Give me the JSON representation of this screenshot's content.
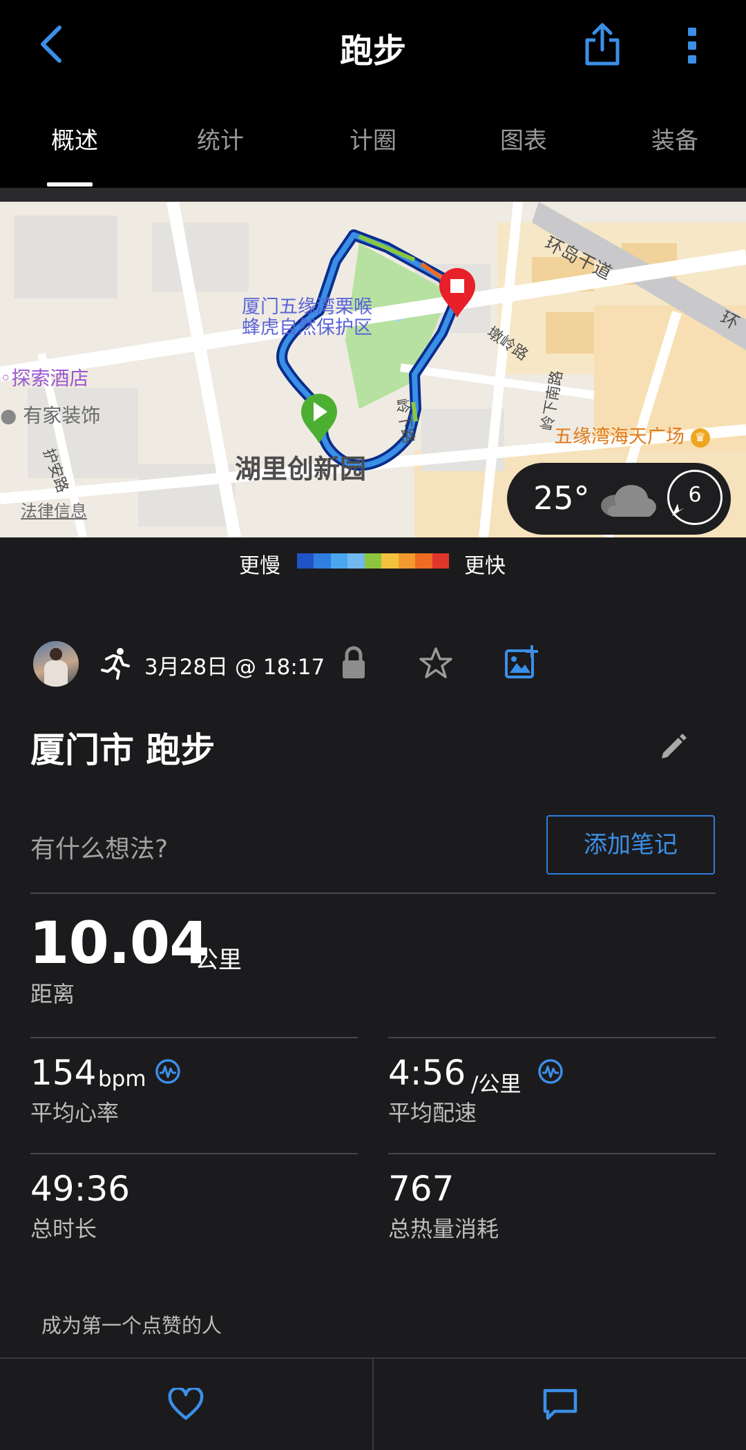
{
  "header": {
    "title": "跑步",
    "back_icon": "chevron-left-icon",
    "share_icon": "share-icon",
    "more_icon": "more-vertical-icon"
  },
  "tabs": [
    {
      "label": "概述",
      "active": true
    },
    {
      "label": "统计",
      "active": false
    },
    {
      "label": "计圈",
      "active": false
    },
    {
      "label": "图表",
      "active": false
    },
    {
      "label": "装备",
      "active": false
    }
  ],
  "map": {
    "labels": {
      "reserve_line1": "厦门五缘湾栗喉",
      "reserve_line2": "蜂虎自然保护区",
      "hotel": "探索酒店",
      "furniture": "有家装饰",
      "park": "湖里创新园",
      "road_huandao": "环岛干道",
      "road_dunling": "墩岭路",
      "road_lingxia": "岭下路",
      "road_lingxia_south": "岭下南路",
      "road_hu_an": "护安路",
      "plaza": "五缘湾海天广场",
      "legal": "法律信息",
      "edge_text": "环"
    },
    "weather": {
      "temperature": "25°",
      "wind": "6"
    }
  },
  "speed_legend": {
    "slower": "更慢",
    "faster": "更快",
    "colors": [
      "#1f54c6",
      "#2e7fe0",
      "#4aa6ef",
      "#73b8ee",
      "#8cc63f",
      "#f3c23c",
      "#f29a2e",
      "#ef6a23",
      "#e0352a"
    ]
  },
  "activity": {
    "datetime": "3月28日 @ 18:17",
    "name": "厦门市 跑步",
    "thought_placeholder": "有什么想法?",
    "add_note_label": "添加笔记"
  },
  "stats": {
    "distance": {
      "value": "10.04",
      "unit": "公里",
      "label": "距离"
    },
    "avg_hr": {
      "value": "154",
      "unit": "bpm",
      "label": "平均心率"
    },
    "avg_pace": {
      "value": "4:56",
      "unit": "/公里",
      "label": "平均配速"
    },
    "duration": {
      "value": "49:36",
      "label": "总时长"
    },
    "calories": {
      "value": "767",
      "label": "总热量消耗"
    }
  },
  "social": {
    "likes_prompt": "成为第一个点赞的人"
  },
  "colors": {
    "accent": "#3c8fe8",
    "background": "#1b1b1d",
    "header": "#000000"
  }
}
